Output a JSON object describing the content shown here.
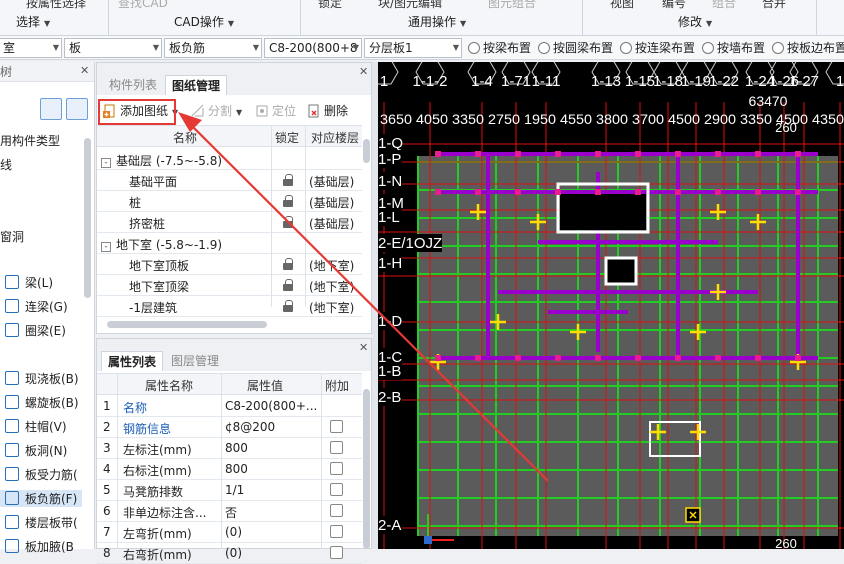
{
  "ribbon": {
    "top_items": [
      "按属性选择",
      "查找CAD",
      "锁定",
      "块/图元编辑",
      "图元组合",
      "视图",
      "编号",
      "组合",
      "合并"
    ],
    "groups": [
      "选择",
      "CAD操作",
      "通用操作",
      "修改"
    ]
  },
  "toolbar": {
    "combo1": "室",
    "combo2": "板",
    "combo3": "板负筋",
    "combo4": "C8-200(800+8",
    "combo5": "分层板1",
    "radios": [
      "按梁布置",
      "按圆梁布置",
      "按连梁布置",
      "按墙布置",
      "按板边布置"
    ]
  },
  "left_tree": {
    "header": "树",
    "items": [
      "用构件类型",
      "线",
      "窗洞"
    ],
    "components": [
      {
        "icon": "beam-icon",
        "label": "梁(L)"
      },
      {
        "icon": "link-beam-icon",
        "label": "连梁(G)"
      },
      {
        "icon": "ring-beam-icon",
        "label": "圈梁(E)"
      },
      {
        "icon": "cast-slab-icon",
        "label": "现浇板(B)"
      },
      {
        "icon": "spiral-slab-icon",
        "label": "螺旋板(B)"
      },
      {
        "icon": "column-cap-icon",
        "label": "柱帽(V)"
      },
      {
        "icon": "slab-hole-icon",
        "label": "板洞(N)"
      },
      {
        "icon": "slab-rebar-icon",
        "label": "板受力筋("
      },
      {
        "icon": "slab-neg-rebar-icon",
        "label": "板负筋(F)"
      },
      {
        "icon": "floor-band-icon",
        "label": "楼层板带("
      },
      {
        "icon": "slab-add-icon",
        "label": "板加腋(B"
      }
    ]
  },
  "drawing_panel": {
    "tabs": [
      "构件列表",
      "图纸管理"
    ],
    "active_tab": 1,
    "tools": {
      "add": "添加图纸",
      "split": "分割",
      "locate": "定位",
      "delete": "删除"
    },
    "columns": [
      "名称",
      "锁定",
      "对应楼层"
    ],
    "groups": [
      {
        "name": "基础层 (-7.5~-5.8)",
        "rows": [
          {
            "name": "基础平面",
            "floor": "(基础层)"
          },
          {
            "name": "桩",
            "floor": "(基础层)"
          },
          {
            "name": "挤密桩",
            "floor": "(基础层)"
          }
        ]
      },
      {
        "name": "地下室 (-5.8~-1.9)",
        "rows": [
          {
            "name": "地下室顶板",
            "floor": "(地下室)"
          },
          {
            "name": "地下室顶梁",
            "floor": "(地下室)"
          },
          {
            "name": "-1层建筑",
            "floor": "(地下室)"
          }
        ]
      }
    ]
  },
  "attr_panel": {
    "tabs": [
      "属性列表",
      "图层管理"
    ],
    "active_tab": 0,
    "columns": [
      "属性名称",
      "属性值",
      "附加"
    ],
    "rows": [
      {
        "no": "1",
        "name": "名称",
        "value": "C8-200(800+...",
        "blue": true,
        "check": false
      },
      {
        "no": "2",
        "name": "钢筋信息",
        "value": "¢8@200",
        "blue": true,
        "check": true
      },
      {
        "no": "3",
        "name": "左标注(mm)",
        "value": "800",
        "blue": false,
        "check": true
      },
      {
        "no": "4",
        "name": "右标注(mm)",
        "value": "800",
        "blue": false,
        "check": true
      },
      {
        "no": "5",
        "name": "马凳筋排数",
        "value": "1/1",
        "blue": false,
        "check": true
      },
      {
        "no": "6",
        "name": "非单边标注含...",
        "value": "否",
        "blue": false,
        "check": true
      },
      {
        "no": "7",
        "name": "左弯折(mm)",
        "value": "(0)",
        "blue": false,
        "check": true
      },
      {
        "no": "8",
        "name": "右弯折(mm)",
        "value": "(0)",
        "blue": false,
        "check": true
      }
    ]
  },
  "canvas": {
    "axis_top": [
      "1",
      "1-1-2",
      "1-4",
      "1-71",
      "1-11",
      "1-13",
      "1-15",
      "1-18",
      "1-19",
      "1-22",
      "1-24",
      "1-26",
      "1-27",
      "1"
    ],
    "dims_top": "3650 4050 3350 2750 1950 4550 3800 3700 4500 2900 3350 4500 4350",
    "dim_mid": "63470",
    "dim_small": "260",
    "axis_left": [
      "1-Q",
      "1-P",
      "1-N",
      "1-M",
      "1-L",
      "2-E/1OJZ",
      "1-H",
      "1-D",
      "1-C",
      "1-B",
      "2-B",
      "2-A"
    ],
    "dim_bottom": "260",
    "colors": {
      "background": "#000000",
      "axis_line": "#d11",
      "grid": "#22cc22",
      "beam": "#9900cc",
      "rebar": "#ffdd00"
    }
  },
  "annotation": {
    "color": "#e53935"
  }
}
